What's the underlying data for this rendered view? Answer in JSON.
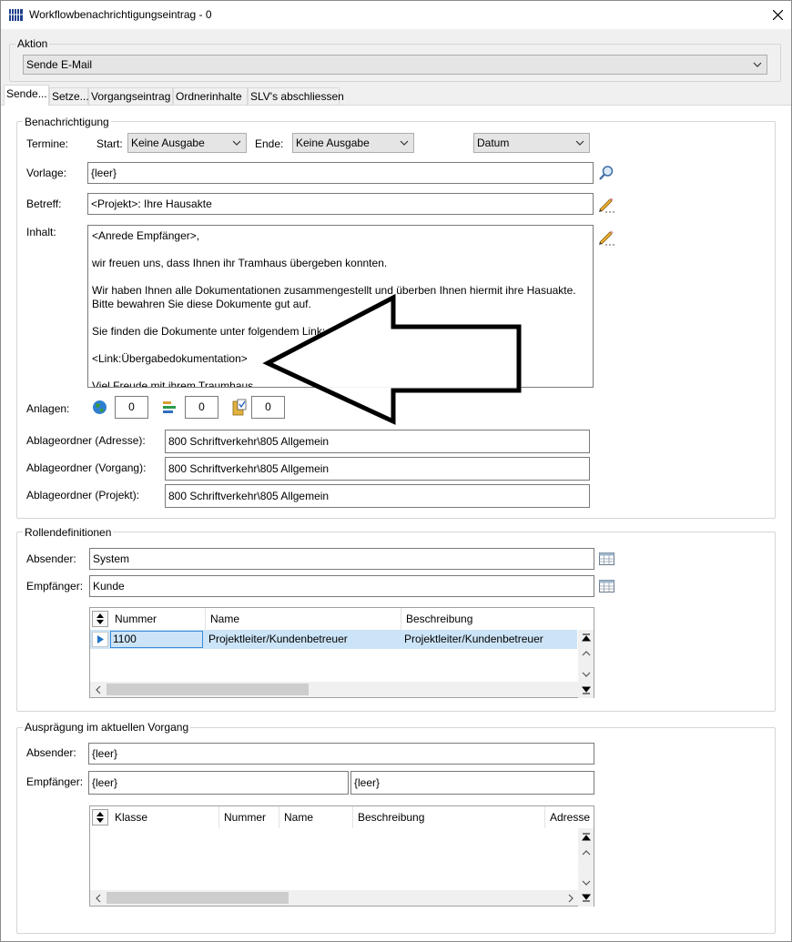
{
  "window": {
    "title": "Workflowbenachrichtigungseintrag - 0"
  },
  "aktion": {
    "group_label": "Aktion",
    "value": "Sende E-Mail"
  },
  "tabs": [
    {
      "label": "Sende..."
    },
    {
      "label": "Setze..."
    },
    {
      "label": "Vorgangseintrag"
    },
    {
      "label": "Ordnerinhalte"
    },
    {
      "label": "SLV's abschliessen"
    }
  ],
  "benachrichtigung": {
    "group_label": "Benachrichtigung",
    "termine_label": "Termine:",
    "start_label": "Start:",
    "start_value": "Keine Ausgabe",
    "ende_label": "Ende:",
    "ende_value": "Keine Ausgabe",
    "datum_value": "Datum",
    "vorlage_label": "Vorlage:",
    "vorlage_value": "{leer}",
    "betreff_label": "Betreff:",
    "betreff_value": "<Projekt>: Ihre Hausakte",
    "inhalt_label": "Inhalt:",
    "inhalt_lines": [
      "<Anrede Empfänger>,",
      "wir freuen uns, dass Ihnen ihr Tramhaus übergeben konnten.",
      "Wir haben Ihnen alle Dokumentationen zusammengestellt und überben Ihnen hiermit ihre Hasuakte.\nBitte bewahren Sie diese Dokumente gut auf.",
      "Sie finden die Dokumente unter folgendem Link:",
      "<Link:Übergabedokumentation>",
      "Viel Freude mit ihrem Traumhaus"
    ],
    "anlagen_label": "Anlagen:",
    "anlagen_counts": [
      "0",
      "0",
      "0"
    ],
    "ablage_adresse_label": "Ablageordner (Adresse):",
    "ablage_adresse_value": "800 Schriftverkehr\\805 Allgemein",
    "ablage_vorgang_label": "Ablageordner (Vorgang):",
    "ablage_vorgang_value": "800 Schriftverkehr\\805 Allgemein",
    "ablage_projekt_label": "Ablageordner (Projekt):",
    "ablage_projekt_value": "800 Schriftverkehr\\805 Allgemein"
  },
  "rollen": {
    "group_label": "Rollendefinitionen",
    "absender_label": "Absender:",
    "absender_value": "System",
    "empfaenger_label": "Empfänger:",
    "empfaenger_value": "Kunde",
    "columns": [
      "Nummer",
      "Name",
      "Beschreibung"
    ],
    "rows": [
      {
        "nummer": "1100",
        "name": "Projektleiter/Kundenbetreuer",
        "beschreibung": "Projektleiter/Kundenbetreuer"
      }
    ]
  },
  "auspraegung": {
    "group_label": "Ausprägung im aktuellen Vorgang",
    "absender_label": "Absender:",
    "absender_value": "{leer}",
    "empfaenger_label": "Empfänger:",
    "empfaenger_value1": "{leer}",
    "empfaenger_value2": "{leer}",
    "columns": [
      "Klasse",
      "Nummer",
      "Name",
      "Beschreibung",
      "Adresse"
    ]
  },
  "colors": {
    "selection": "#cce4f7",
    "accent": "#0078d7",
    "arrow_fill": "#ffffff",
    "arrow_stroke": "#000000"
  }
}
